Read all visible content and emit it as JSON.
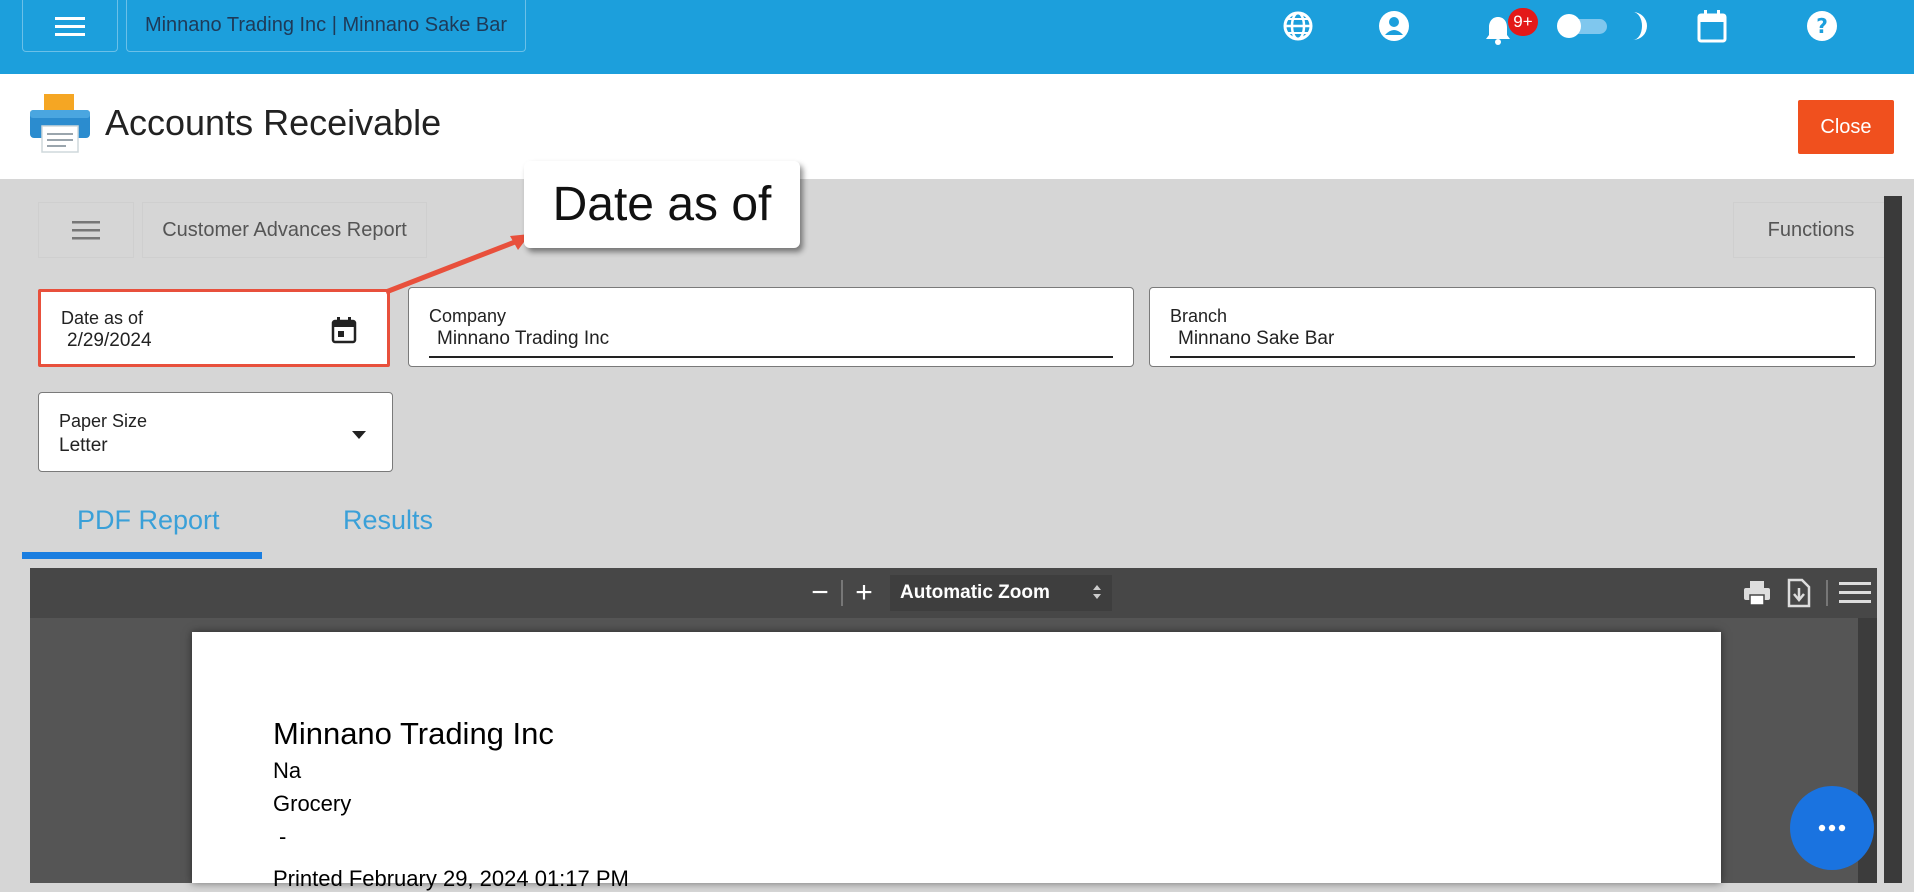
{
  "topbar": {
    "tenant": "Minnano Trading Inc | Minnano Sake Bar",
    "notification_count": "9+",
    "icons": [
      "menu-icon",
      "globe-icon",
      "account-icon",
      "bell-icon",
      "dark-mode-toggle",
      "moon-icon",
      "calendar-icon",
      "help-icon"
    ]
  },
  "header": {
    "title": "Accounts Receivable",
    "close_label": "Close"
  },
  "toolbar": {
    "report_name": "Customer Advances Report",
    "functions_label": "Functions"
  },
  "callout": {
    "text": "Date as of"
  },
  "filters": {
    "date": {
      "label": "Date as of",
      "value": "2/29/2024"
    },
    "company": {
      "label": "Company",
      "value": "Minnano Trading Inc"
    },
    "branch": {
      "label": "Branch",
      "value": "Minnano Sake Bar"
    },
    "paper": {
      "label": "Paper Size",
      "value": "Letter"
    }
  },
  "tabs": [
    {
      "label": "PDF Report",
      "active": true
    },
    {
      "label": "Results",
      "active": false
    }
  ],
  "pdf_viewer": {
    "zoom_out": "−",
    "zoom_in": "+",
    "zoom": "Automatic Zoom"
  },
  "pdf_page": {
    "company": "Minnano Trading Inc",
    "line1": "Na",
    "line2": "Grocery",
    "line3": "-",
    "printed": "Printed February 29, 2024 01:17 PM"
  },
  "colors": {
    "topbar": "#1c9fdc",
    "close_button": "#f0501e",
    "tab_active": "#1a7ee0",
    "highlight": "#e8503c"
  }
}
